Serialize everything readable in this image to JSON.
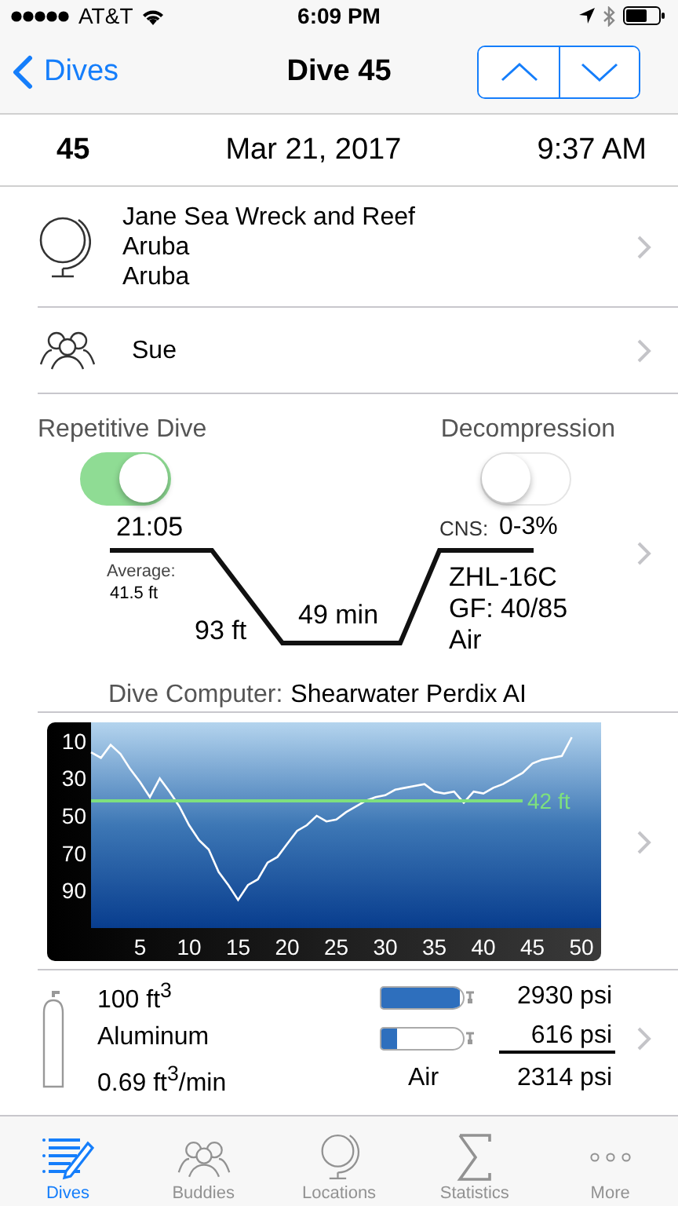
{
  "status_bar": {
    "carrier": "AT&T",
    "time": "6:09 PM"
  },
  "nav": {
    "back": "Dives",
    "title": "Dive 45"
  },
  "header": {
    "number": "45",
    "date": "Mar 21, 2017",
    "time": "9:37 AM"
  },
  "location": {
    "lines": [
      "Jane Sea Wreck and Reef",
      "Aruba",
      "Aruba"
    ]
  },
  "buddies": {
    "names": "Sue"
  },
  "summary": {
    "toggles": [
      {
        "label": "Repetitive Dive",
        "on": true
      },
      {
        "label": "Decompression",
        "on": false
      }
    ],
    "start_time": "21:05",
    "average_label": "Average:",
    "average": "41.5 ft",
    "max_depth": "93 ft",
    "duration": "49 min",
    "cns_label": "CNS:",
    "cns": "0-3%",
    "algorithm": "ZHL-16C",
    "gf": "GF: 40/85",
    "gas": "Air",
    "computer_label": "Dive Computer:",
    "computer": "Shearwater Perdix AI"
  },
  "profile": {
    "chart_data": {
      "type": "line",
      "x": [
        0,
        1,
        2,
        3,
        4,
        5,
        6,
        7,
        8,
        9,
        10,
        11,
        12,
        13,
        14,
        15,
        16,
        17,
        18,
        19,
        20,
        21,
        22,
        23,
        24,
        25,
        26,
        27,
        28,
        29,
        30,
        31,
        32,
        33,
        34,
        35,
        36,
        37,
        38,
        39,
        40,
        41,
        42,
        43,
        44,
        45,
        46,
        47,
        48,
        49
      ],
      "series": [
        {
          "color": "#ffffff",
          "values": [
            16,
            19,
            12,
            17,
            25,
            32,
            40,
            30,
            37,
            45,
            55,
            63,
            68,
            80,
            87,
            95,
            87,
            84,
            75,
            72,
            65,
            58,
            55,
            50,
            53,
            52,
            48,
            45,
            42,
            40,
            39,
            36,
            35,
            34,
            33,
            37,
            38,
            37,
            43,
            37,
            38,
            35,
            33,
            30,
            27,
            22,
            20,
            19,
            18,
            8
          ]
        },
        {
          "name": "42 ft",
          "color": "#7ee07e",
          "values": [
            42,
            42,
            42,
            42,
            42,
            42,
            42,
            42,
            42,
            42,
            42,
            42,
            42,
            42,
            42,
            42,
            42,
            42,
            42,
            42,
            42,
            42,
            42,
            42,
            42,
            42,
            42,
            42,
            42,
            42,
            42,
            42,
            42,
            42,
            42,
            42,
            42,
            42,
            42,
            42,
            42,
            42,
            42,
            42,
            42,
            null,
            null,
            null,
            null,
            null
          ]
        }
      ],
      "xlim": [
        0,
        52
      ],
      "ylim": [
        110,
        0
      ],
      "xticks": [
        5,
        10,
        15,
        20,
        25,
        30,
        35,
        40,
        45,
        50
      ],
      "yticks": [
        10,
        30,
        50,
        70,
        90
      ]
    }
  },
  "tank": {
    "size": "100 ft$^{3}$",
    "material": "Aluminum",
    "sac": "0.69 ft$^{3}$/min",
    "gas": "Air",
    "gauges": [
      {
        "level": 0.97,
        "reading": "2930 psi"
      },
      {
        "level": 0.2,
        "reading": "616 psi"
      }
    ],
    "used": "2314 psi"
  },
  "tab_bar": [
    {
      "label": "Dives",
      "selected": true
    },
    {
      "label": "Buddies",
      "selected": false
    },
    {
      "label": "Locations",
      "selected": false
    },
    {
      "label": "Statistics",
      "selected": false
    },
    {
      "label": "More",
      "selected": false
    }
  ]
}
